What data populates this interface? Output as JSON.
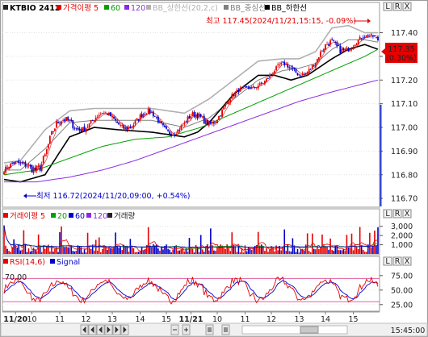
{
  "header": {
    "symbol": "KTBIO 2412",
    "legend": [
      {
        "text": "가격이평 5",
        "color": "#e60000"
      },
      {
        "text": "60",
        "color": "#00a000"
      },
      {
        "text": "120",
        "color": "#8a2be2"
      },
      {
        "text": "BB_상한선(20,2,c)",
        "color": "#b0b0b0"
      },
      {
        "text": "BB_중심선",
        "color": "#808080"
      },
      {
        "text": "BB_하한선",
        "color": "#000000"
      }
    ],
    "window_buttons": [
      "L",
      "R",
      "X"
    ]
  },
  "price_panel": {
    "high_note": "최고 117.45(2024/11/21,15:15, -0.09%)",
    "low_note": "최저 116.72(2024/11/20,09:00, +0.54%)",
    "current_price": "117.35",
    "current_change": "(0.30%)",
    "y_ticks": [
      "117.40",
      "117.30",
      "117.20",
      "117.10",
      "117.00",
      "116.90",
      "116.80",
      "116.70"
    ],
    "up_color": "#e60000",
    "down_color": "#0000cc"
  },
  "volume_panel": {
    "legend": [
      {
        "text": "거래이평 5",
        "color": "#e60000"
      },
      {
        "text": "20",
        "color": "#00a000"
      },
      {
        "text": "60",
        "color": "#0000cc"
      },
      {
        "text": "120",
        "color": "#8a2be2"
      },
      {
        "text": "거래량",
        "color": "#222222"
      }
    ],
    "y_ticks": [
      "3,000",
      "2,000",
      "1,000"
    ]
  },
  "rsi_panel": {
    "legend": [
      {
        "text": "RSI(14,6)",
        "color": "#e60000"
      },
      {
        "text": "Signal",
        "color": "#0000cc"
      }
    ],
    "level_label": "70.00",
    "y_ticks": [
      "75.00",
      "50.00",
      "25.00"
    ]
  },
  "x_axis": {
    "labels": [
      "11/20",
      "10",
      "11",
      "12",
      "13",
      "14",
      "15",
      "11/21",
      "10",
      "11",
      "12",
      "13",
      "14",
      "15"
    ]
  },
  "footer": {
    "time": "15:45:00"
  },
  "chart_data": {
    "type": "candlestick",
    "ylim": [
      116.68,
      117.47
    ],
    "high": 117.45,
    "low": 116.72,
    "last": 117.35,
    "bb_upper": [
      [
        0,
        116.85
      ],
      [
        10,
        116.86
      ],
      [
        25,
        116.99
      ],
      [
        40,
        117.07
      ],
      [
        55,
        117.08
      ],
      [
        70,
        117.08
      ],
      [
        90,
        117.08
      ],
      [
        110,
        117.06
      ],
      [
        125,
        117.12
      ],
      [
        140,
        117.2
      ],
      [
        155,
        117.28
      ],
      [
        170,
        117.29
      ],
      [
        180,
        117.29
      ],
      [
        190,
        117.32
      ],
      [
        200,
        117.42
      ],
      [
        210,
        117.43
      ],
      [
        220,
        117.4
      ],
      [
        228,
        117.4
      ]
    ],
    "bb_mid": [
      [
        0,
        116.82
      ],
      [
        10,
        116.82
      ],
      [
        25,
        116.91
      ],
      [
        40,
        117.02
      ],
      [
        55,
        117.03
      ],
      [
        70,
        117.03
      ],
      [
        90,
        117.03
      ],
      [
        110,
        117.0
      ],
      [
        125,
        117.04
      ],
      [
        140,
        117.12
      ],
      [
        155,
        117.2
      ],
      [
        170,
        117.24
      ],
      [
        180,
        117.25
      ],
      [
        190,
        117.27
      ],
      [
        200,
        117.33
      ],
      [
        210,
        117.37
      ],
      [
        220,
        117.37
      ],
      [
        228,
        117.36
      ]
    ],
    "bb_lower": [
      [
        0,
        116.78
      ],
      [
        10,
        116.77
      ],
      [
        25,
        116.8
      ],
      [
        40,
        116.96
      ],
      [
        55,
        117.0
      ],
      [
        70,
        116.99
      ],
      [
        90,
        116.98
      ],
      [
        100,
        116.97
      ],
      [
        110,
        116.96
      ],
      [
        118,
        116.98
      ],
      [
        125,
        117.02
      ],
      [
        140,
        117.14
      ],
      [
        155,
        117.22
      ],
      [
        165,
        117.22
      ],
      [
        175,
        117.2
      ],
      [
        185,
        117.22
      ],
      [
        200,
        117.29
      ],
      [
        210,
        117.33
      ],
      [
        220,
        117.35
      ],
      [
        228,
        117.33
      ]
    ],
    "ma60": [
      [
        0,
        116.8
      ],
      [
        20,
        116.82
      ],
      [
        40,
        116.87
      ],
      [
        60,
        116.92
      ],
      [
        80,
        116.95
      ],
      [
        100,
        116.96
      ],
      [
        120,
        117.0
      ],
      [
        140,
        117.06
      ],
      [
        160,
        117.12
      ],
      [
        180,
        117.18
      ],
      [
        200,
        117.24
      ],
      [
        220,
        117.3
      ],
      [
        228,
        117.33
      ]
    ],
    "ma120": [
      [
        0,
        116.77
      ],
      [
        20,
        116.77
      ],
      [
        40,
        116.79
      ],
      [
        60,
        116.82
      ],
      [
        80,
        116.86
      ],
      [
        100,
        116.91
      ],
      [
        120,
        116.96
      ],
      [
        140,
        117.01
      ],
      [
        160,
        117.06
      ],
      [
        180,
        117.11
      ],
      [
        200,
        117.15
      ],
      [
        228,
        117.2
      ]
    ],
    "volume_range": [
      0,
      3500
    ],
    "rsi_range": [
      15,
      90
    ],
    "rsi_level": 70,
    "rsi_low_level": 30
  }
}
